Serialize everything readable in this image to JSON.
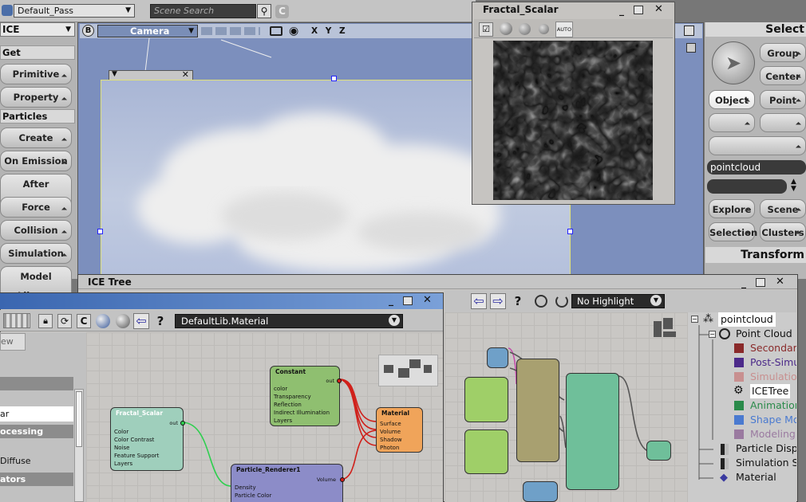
{
  "top": {
    "pass": "Default_Pass",
    "search_placeholder": "Scene Search"
  },
  "toolbar": {
    "mode": "ICE",
    "get": "Get",
    "particles": "Particles",
    "buttons": [
      "Primitive",
      "Property",
      "Create",
      "On Emission",
      "After Emission",
      "Force",
      "Collision",
      "Simulation",
      "Model Library"
    ]
  },
  "viewport": {
    "badge": "B",
    "camera": "Camera",
    "axes": "X Y Z"
  },
  "fractal": {
    "title": "Fractal_Scalar",
    "auto": "AUTO"
  },
  "right": {
    "select": "Select",
    "group": "Group",
    "center": "Center",
    "object": "Object",
    "point": "Point",
    "filter": "pointcloud",
    "explore": "Explore",
    "scene": "Scene",
    "selection": "Selection",
    "clusters": "Clusters",
    "transform": "Transform"
  },
  "ice": {
    "title": "ICE Tree",
    "highlight": "No Highlight"
  },
  "render": {
    "library": "DefaultLib.Material"
  },
  "left_partial": {
    "items": [
      "ew",
      "ar",
      "ocessing",
      "Diffuse",
      "ators"
    ]
  },
  "nodes": {
    "constant": {
      "title": "Constant",
      "out": "out",
      "ports": [
        "color",
        "Transparency",
        "Reflection",
        "Indirect Illumination",
        "Layers"
      ]
    },
    "fractal": {
      "title": "Fractal_Scalar",
      "out": "out",
      "ports": [
        "Color",
        "Color Contrast",
        "Noise",
        "Feature Support",
        "Layers"
      ]
    },
    "material": {
      "title": "Material",
      "ports": [
        "Surface",
        "Volume",
        "Shadow",
        "Photon"
      ]
    },
    "renderer": {
      "title": "Particle_Renderer1",
      "volume": "Volume",
      "ports": [
        "Density",
        "Particle Color"
      ]
    }
  },
  "explorer": {
    "root": "pointcloud",
    "child": "Point Cloud",
    "items": [
      "Secondar",
      "Post-Simu",
      "Simulation",
      "ICETree",
      "Animation",
      "Shape Mo",
      "Modeling",
      "Particle Displ",
      "Simulation S",
      "Material"
    ],
    "colors": {
      "secondar": "#8a2a2a",
      "post": "#4c2a8a",
      "sim": "#c89090",
      "anim": "#2a8a4a",
      "shape": "#4a7ad0",
      "model": "#9a7aa0"
    }
  }
}
